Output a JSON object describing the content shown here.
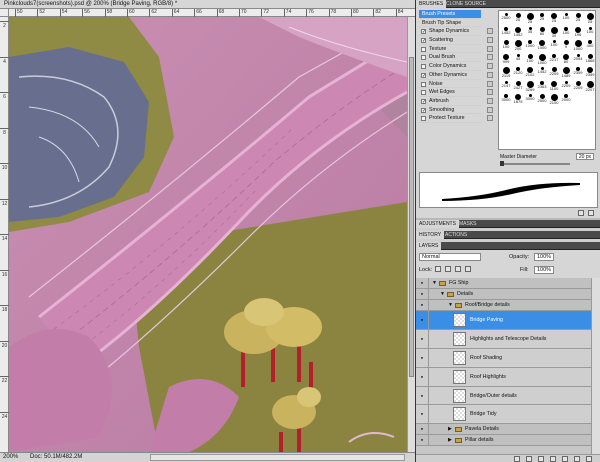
{
  "document": {
    "title": "Pinkclouds7(screenshots).psd @ 200% (Bridge Paving, RGB/8) *",
    "ruler_top_ticks": [
      "50",
      "52",
      "54",
      "56",
      "58",
      "60",
      "62",
      "64",
      "66",
      "68",
      "70",
      "72",
      "74",
      "76",
      "78",
      "80",
      "82",
      "84"
    ],
    "ruler_left_ticks": [
      "2",
      "4",
      "6",
      "8",
      "10",
      "12",
      "14",
      "16",
      "18",
      "20",
      "22",
      "24"
    ],
    "status": {
      "zoom": "200%",
      "doc_size": "Doc: 50.1M/482.2M"
    }
  },
  "brushes": {
    "tabs": [
      {
        "label": "BRUSHES"
      },
      {
        "label": "CLONE SOURCE"
      }
    ],
    "options": [
      {
        "label": "Brush Presets",
        "kind": "highlight"
      },
      {
        "label": "Brush Tip Shape",
        "kind": "plain"
      },
      {
        "label": "Shape Dynamics",
        "checked": "✓"
      },
      {
        "label": "Scattering",
        "checked": "✓"
      },
      {
        "label": "Texture",
        "checked": ""
      },
      {
        "label": "Dual Brush",
        "checked": ""
      },
      {
        "label": "Color Dynamics",
        "checked": ""
      },
      {
        "label": "Other Dynamics",
        "checked": "✓"
      },
      {
        "label": "Noise",
        "checked": ""
      },
      {
        "label": "Wet Edges",
        "checked": ""
      },
      {
        "label": "Airbrush",
        "checked": "✓"
      },
      {
        "label": "Smoothing",
        "checked": "✓"
      },
      {
        "label": "Protect Texture",
        "checked": ""
      }
    ],
    "tip_sizes": [
      "2500",
      "25",
      "25",
      "25",
      "25",
      "100",
      "25",
      "25",
      "1452",
      "1452",
      "35",
      "80",
      "30",
      "100",
      "196",
      "100",
      "100",
      "200",
      "1000",
      "1000",
      "100",
      "9",
      "1000",
      "400",
      "999",
      "45",
      "100",
      "1000",
      "2217",
      "80",
      "2094",
      "1868",
      "2119",
      "2120",
      "2102",
      "1452",
      "2209",
      "1489",
      "2359",
      "2359",
      "2147",
      "2427",
      "3269",
      "2363",
      "1100",
      "2209",
      "2209",
      "2207",
      "3000",
      "1875",
      "3000",
      "2500",
      "2100",
      "2000"
    ],
    "master_diameter_label": "Master Diameter",
    "master_diameter_value": "20 px"
  },
  "panel_tabs": {
    "adjustments": [
      {
        "label": "ADJUSTMENTS"
      },
      {
        "label": "MASKS"
      }
    ],
    "history": [
      {
        "label": "HISTORY"
      },
      {
        "label": "ACTIONS"
      }
    ],
    "layers": [
      {
        "label": "LAYERS"
      }
    ]
  },
  "layers": {
    "blend_mode": "Normal",
    "opacity_label": "Opacity:",
    "opacity_value": "100%",
    "lock_label": "Lock:",
    "fill_label": "Fill:",
    "fill_value": "100%",
    "rows": [
      {
        "name": "FG Ship",
        "kind": "group",
        "indent": 0,
        "arrow": "▼"
      },
      {
        "name": "Details",
        "kind": "group",
        "indent": 1,
        "arrow": "▼"
      },
      {
        "name": "Roof/Bridge details",
        "kind": "group",
        "indent": 2,
        "arrow": "▼"
      },
      {
        "name": "Bridge Paving",
        "kind": "layer",
        "selected": true
      },
      {
        "name": "Highlights and Telescope Details",
        "kind": "layer"
      },
      {
        "name": "Roof Shading",
        "kind": "layer"
      },
      {
        "name": "Roof Highlights",
        "kind": "layer"
      },
      {
        "name": "Bridge/Outer details",
        "kind": "layer"
      },
      {
        "name": "Bridge Tidy",
        "kind": "layer"
      },
      {
        "name": "Pavela Details",
        "kind": "group",
        "indent": 2,
        "arrow": "▶"
      },
      {
        "name": "Pillar details",
        "kind": "group",
        "indent": 2,
        "arrow": "▶"
      }
    ]
  }
}
